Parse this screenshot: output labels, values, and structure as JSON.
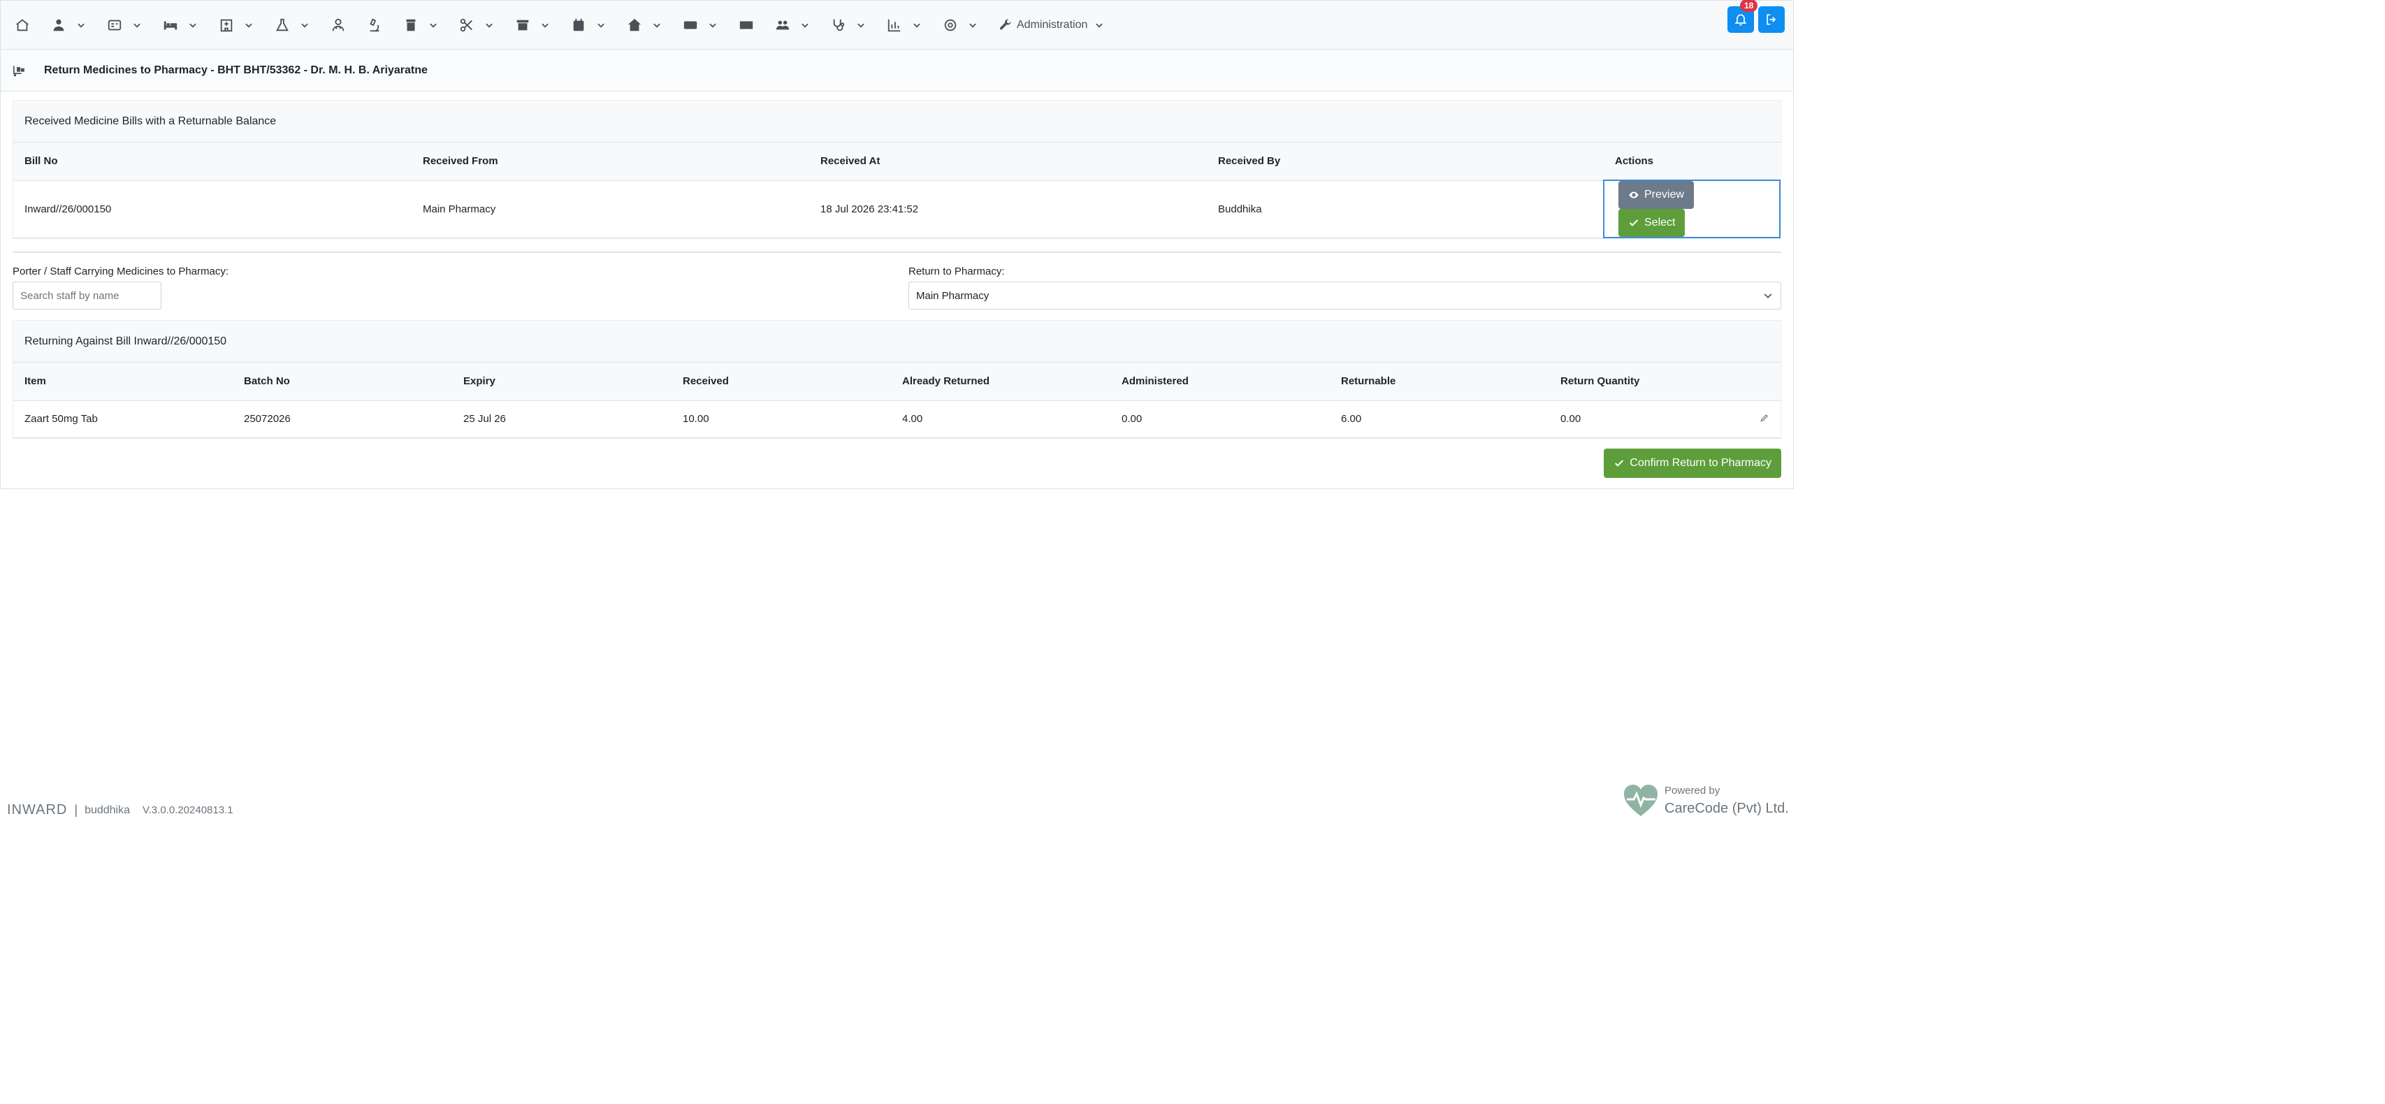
{
  "nav": {
    "admin_label": "Administration",
    "notification_count": "18"
  },
  "header": {
    "title": "Return Medicines to Pharmacy - BHT BHT/53362 - Dr. M. H. B. Ariyaratne"
  },
  "bills": {
    "card_title": "Received Medicine Bills with a Returnable Balance",
    "columns": [
      "Bill No",
      "Received From",
      "Received At",
      "Received By",
      "Actions"
    ],
    "rows": [
      {
        "bill_no": "Inward//26/000150",
        "received_from": "Main Pharmacy",
        "received_at": "18 Jul 2026 23:41:52",
        "received_by": "Buddhika"
      }
    ],
    "preview_label": "Preview",
    "select_label": "Select"
  },
  "form": {
    "porter_label": "Porter / Staff Carrying Medicines to Pharmacy:",
    "porter_placeholder": "Search staff by name",
    "pharmacy_label": "Return to Pharmacy:",
    "pharmacy_value": "Main Pharmacy"
  },
  "items": {
    "card_title": "Returning Against Bill Inward//26/000150",
    "columns": [
      "Item",
      "Batch No",
      "Expiry",
      "Received",
      "Already Returned",
      "Administered",
      "Returnable",
      "Return Quantity"
    ],
    "rows": [
      {
        "item": "Zaart 50mg Tab",
        "batch": "25072026",
        "expiry": "25 Jul 26",
        "received": "10.00",
        "already_returned": "4.00",
        "administered": "0.00",
        "returnable": "6.00",
        "return_qty": "0.00"
      }
    ],
    "confirm_label": "Confirm Return to Pharmacy"
  },
  "footer": {
    "app_name": "INWARD",
    "separator": "|",
    "user": "buddhika",
    "version": "V.3.0.0.20240813.1",
    "powered_by": "Powered by",
    "company": "CareCode (Pvt) Ltd."
  }
}
